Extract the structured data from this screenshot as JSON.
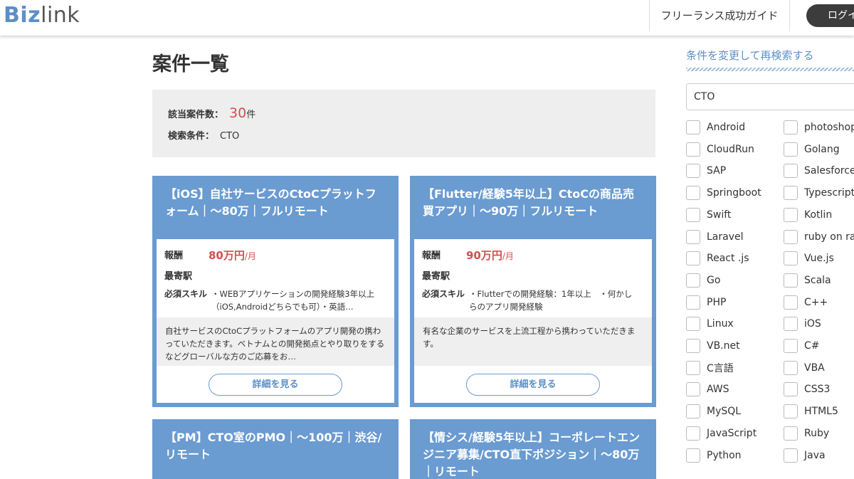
{
  "header": {
    "logo_biz": "Biz",
    "logo_link": "link",
    "nav_guide": "フリーランス成功ガイド",
    "login_label": "ログイン"
  },
  "main": {
    "title": "案件一覧",
    "summary": {
      "count_label": "該当案件数：",
      "count_value": "30",
      "count_unit": "件",
      "condition_label": "検索条件：",
      "condition_value": "CTO"
    },
    "cards": [
      {
        "title": "【iOS】自社サービスのCtoCプラットフォーム｜～80万｜フルリモート",
        "salary_label": "報酬",
        "salary_value": "80万円",
        "salary_unit": "/月",
        "station_label": "最寄駅",
        "skill_label": "必須スキル",
        "skill_text": "・WEBアプリケーションの開発経験3年以上（iOS,Androidどちらでも可）・英語…",
        "description": "自社サービスのCtoCプラットフォームのアプリ開発の携わっていただきます。ベトナムとの開発拠点とやり取りをするなどグローバルな方のご応募をお…",
        "button": "詳細を見る"
      },
      {
        "title": "【Flutter/経験5年以上】CtoCの商品売買アプリ｜～90万｜フルリモート",
        "salary_label": "報酬",
        "salary_value": "90万円",
        "salary_unit": "/月",
        "station_label": "最寄駅",
        "skill_label": "必須スキル",
        "skill_text": "・Flutterでの開発経験：1年以上　・何かしらのアプリ開発経験",
        "description": "有名な企業のサービスを上流工程から携わっていただきます。",
        "button": "詳細を見る"
      },
      {
        "title": "【PM】CTO室のPMO｜～100万｜渋谷/リモート"
      },
      {
        "title": "【情シス/経験5年以上】コーポレートエンジニア募集/CTO直下ポジション｜～80万｜リモート"
      }
    ]
  },
  "sidebar": {
    "title": "条件を変更して再検索する",
    "search_value": "CTO",
    "left_options": [
      "Android",
      "CloudRun",
      "SAP",
      "Springboot",
      "Swift",
      "Laravel",
      "React .js",
      "Go",
      "PHP",
      "Linux",
      "VB.net",
      "C言語",
      "AWS",
      "MySQL",
      "JavaScript",
      "Python"
    ],
    "right_options": [
      "photoshop",
      "Golang",
      "Salesforce",
      "Typescript",
      "Kotlin",
      "ruby on rails",
      "Vue.js",
      "Scala",
      "C++",
      "iOS",
      "C#",
      "VBA",
      "CSS3",
      "HTML5",
      "Ruby",
      "Java"
    ]
  }
}
